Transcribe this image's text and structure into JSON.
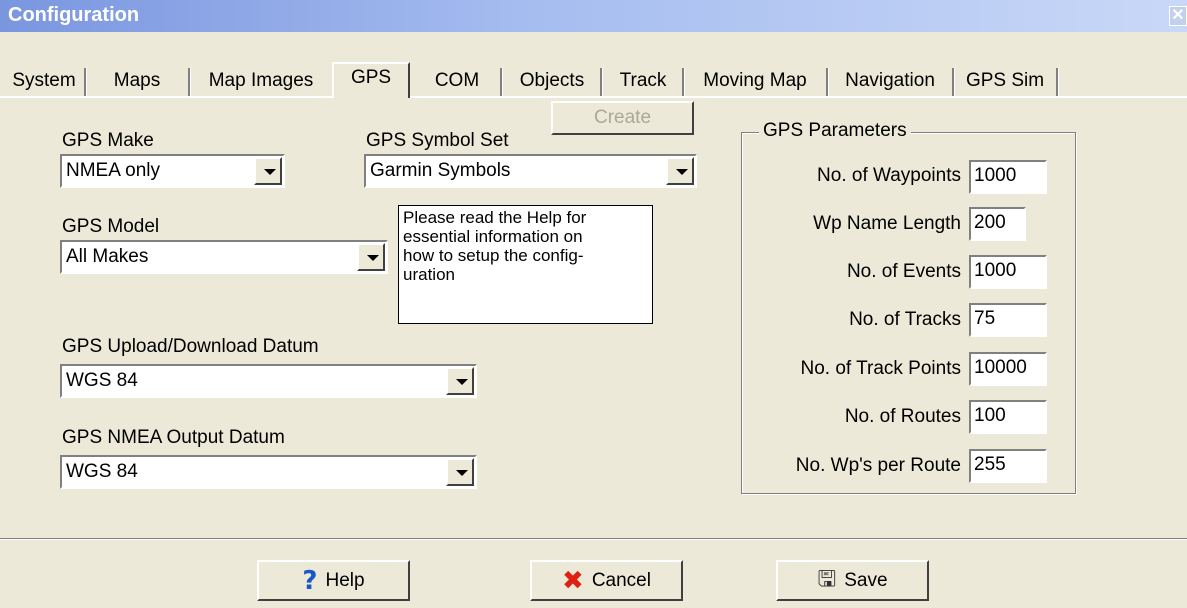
{
  "window": {
    "title": "Configuration",
    "close_glyph": "✕"
  },
  "tabs": [
    {
      "label": "System"
    },
    {
      "label": "Maps"
    },
    {
      "label": "Map Images"
    },
    {
      "label": "GPS",
      "active": true
    },
    {
      "label": "COM"
    },
    {
      "label": "Objects"
    },
    {
      "label": "Track"
    },
    {
      "label": "Moving Map"
    },
    {
      "label": "Navigation"
    },
    {
      "label": "GPS Sim"
    }
  ],
  "gps": {
    "make_label": "GPS Make",
    "make_value": "NMEA only",
    "symbol_set_label": "GPS Symbol Set",
    "symbol_set_value": "Garmin Symbols",
    "create_label": "Create",
    "model_label": "GPS Model",
    "model_value": "All Makes",
    "note": "Please read the Help for essential information on how to setup the configuration",
    "note_lines": [
      "Please read the Help for",
      "essential information on",
      "how to setup the config-",
      "uration"
    ],
    "upload_datum_label": "GPS Upload/Download Datum",
    "upload_datum_value": "WGS 84",
    "nmea_datum_label": "GPS NMEA Output Datum",
    "nmea_datum_value": "WGS 84"
  },
  "params": {
    "title": "GPS Parameters",
    "items": [
      {
        "label": "No. of Waypoints",
        "value": "1000"
      },
      {
        "label": "Wp Name Length",
        "value": "200"
      },
      {
        "label": "No. of Events",
        "value": "1000"
      },
      {
        "label": "No. of Tracks",
        "value": "75"
      },
      {
        "label": "No. of Track Points",
        "value": "10000"
      },
      {
        "label": "No. of Routes",
        "value": "100"
      },
      {
        "label": "No. Wp's per Route",
        "value": "255"
      }
    ]
  },
  "buttons": {
    "help": "Help",
    "cancel": "Cancel",
    "save": "Save"
  },
  "icons": {
    "help": "question-icon",
    "cancel": "cross-icon",
    "save": "save-icon"
  },
  "colors": {
    "titlebar_start": "#7a96df",
    "titlebar_end": "#c9d8f7",
    "face": "#ece9d8",
    "help_icon": "#1a56c8",
    "cancel_icon": "#e02010"
  }
}
